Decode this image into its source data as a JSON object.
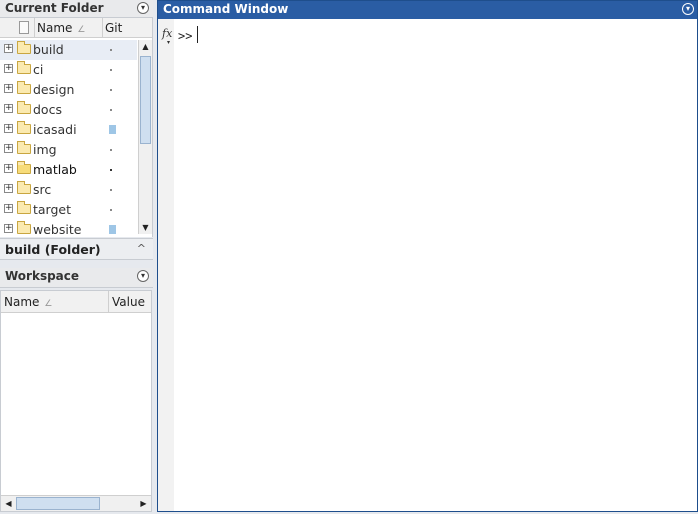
{
  "current_folder": {
    "title": "Current Folder",
    "columns": {
      "name": "Name",
      "git": "Git"
    },
    "sort_icon": "∠",
    "items": [
      {
        "name": "build",
        "git": "dot",
        "selected": true,
        "dark": false
      },
      {
        "name": "ci",
        "git": "dot",
        "selected": false,
        "dark": false
      },
      {
        "name": "design",
        "git": "dot",
        "selected": false,
        "dark": false
      },
      {
        "name": "docs",
        "git": "dot",
        "selected": false,
        "dark": false
      },
      {
        "name": "icasadi",
        "git": "blue",
        "selected": false,
        "dark": false
      },
      {
        "name": "img",
        "git": "dot",
        "selected": false,
        "dark": false
      },
      {
        "name": "matlab",
        "git": "dot",
        "selected": false,
        "dark": true
      },
      {
        "name": "src",
        "git": "dot",
        "selected": false,
        "dark": false
      },
      {
        "name": "target",
        "git": "dot",
        "selected": false,
        "dark": false
      },
      {
        "name": "website",
        "git": "blue",
        "selected": false,
        "dark": false
      }
    ],
    "details": "build  (Folder)",
    "details_caret": "^"
  },
  "workspace": {
    "title": "Workspace",
    "columns": {
      "name": "Name",
      "value": "Value"
    }
  },
  "command_window": {
    "title": "Command Window",
    "fx": "fx",
    "prompt": ">>"
  },
  "icons": {
    "menu": "▾",
    "expand": "+",
    "scroll_up": "▲",
    "scroll_down": "▼",
    "scroll_left": "◀",
    "scroll_right": "▶"
  },
  "colors": {
    "accent": "#2a5da4",
    "git_modified": "#9ec6e6"
  }
}
